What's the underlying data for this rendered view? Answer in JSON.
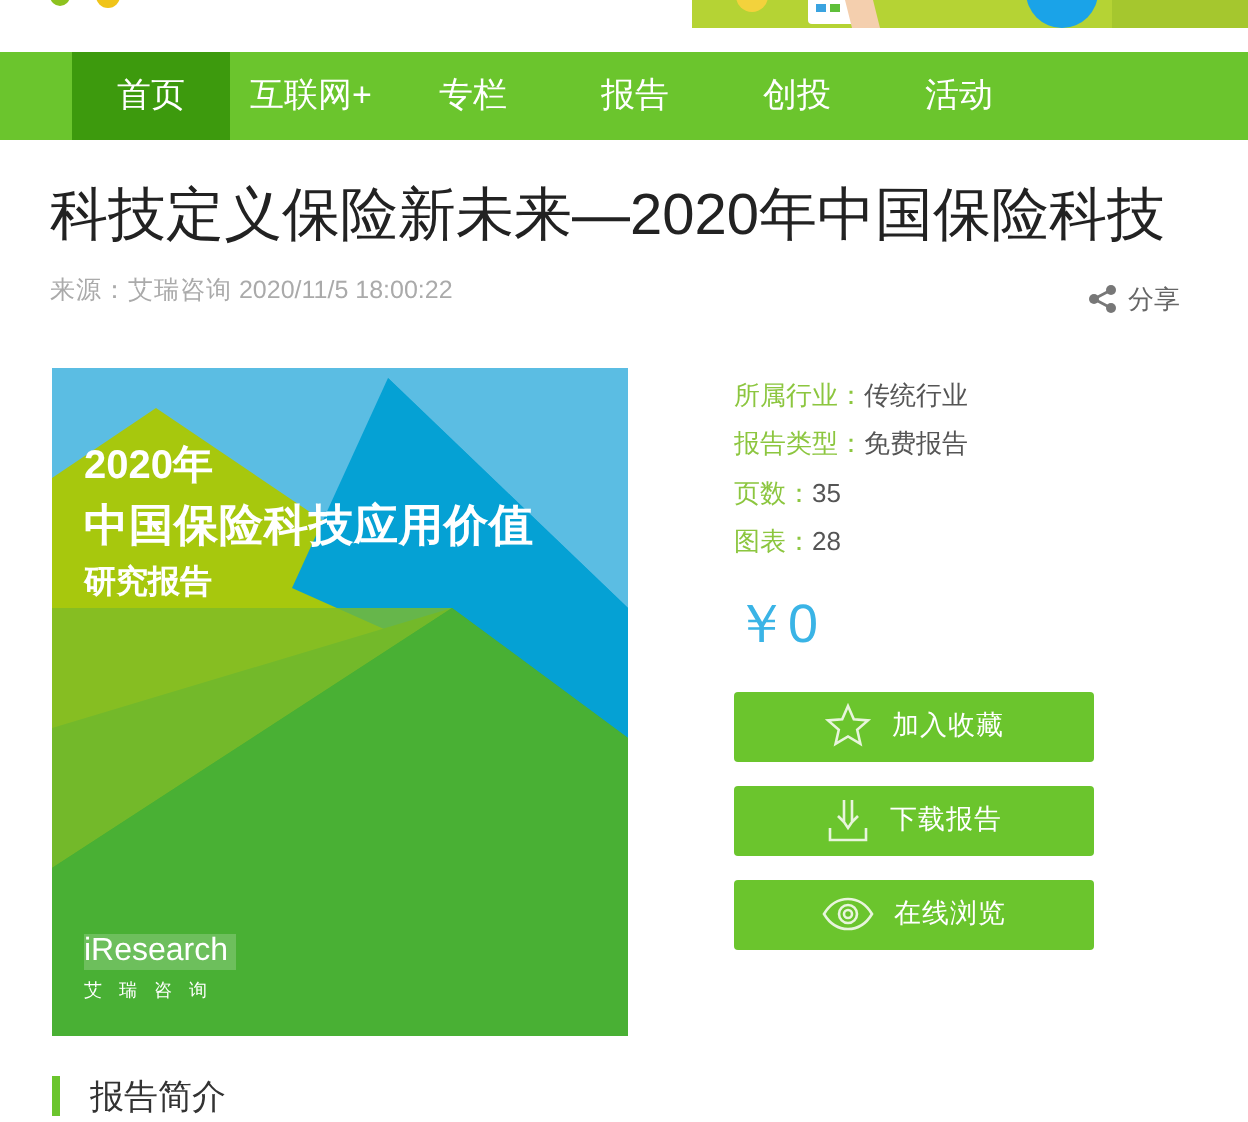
{
  "nav": [
    {
      "label": "首页",
      "selected": true
    },
    {
      "label": "互联网+",
      "selected": false
    },
    {
      "label": "专栏",
      "selected": false
    },
    {
      "label": "报告",
      "selected": false
    },
    {
      "label": "创投",
      "selected": false
    },
    {
      "label": "活动",
      "selected": false
    }
  ],
  "article": {
    "title": "科技定义保险新未来—2020年中国保险科技",
    "meta": "来源：艾瑞咨询 2020/11/5 18:00:22",
    "share": "分享"
  },
  "cover": {
    "lines": [
      "2020年",
      "中国保险科技应用价值",
      "研究报告"
    ],
    "brand": "iResearch",
    "brand_sub": "艾 瑞 咨 询"
  },
  "details": [
    {
      "label": "所属行业：",
      "value": "传统行业"
    },
    {
      "label": "报告类型：",
      "value": "免费报告"
    },
    {
      "label": "页数：",
      "value": "35"
    },
    {
      "label": "图表：",
      "value": "28"
    }
  ],
  "price": "￥0",
  "actions": [
    {
      "kind": "favorite",
      "label": "加入收藏"
    },
    {
      "kind": "download",
      "label": "下载报告"
    },
    {
      "kind": "view",
      "label": "在线浏览"
    }
  ],
  "section": {
    "title": "报告简介"
  }
}
